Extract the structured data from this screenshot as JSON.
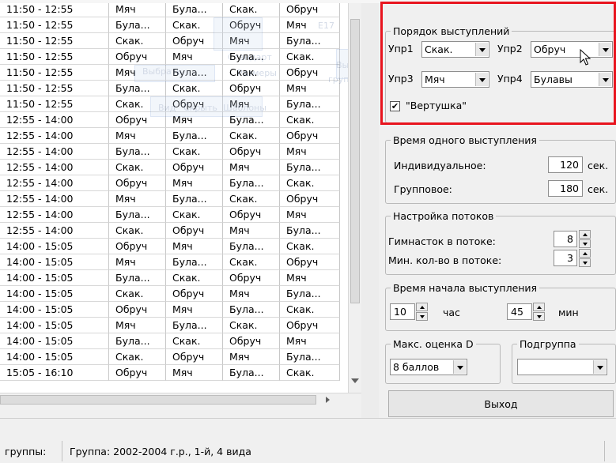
{
  "grid": {
    "rows": [
      [
        "11:50 - 12:55",
        "Мяч",
        "Була...",
        "Скак.",
        "Обруч"
      ],
      [
        "11:50 - 12:55",
        "Була...",
        "Скак.",
        "Обруч",
        "Мяч"
      ],
      [
        "11:50 - 12:55",
        "Скак.",
        "Обруч",
        "Мяч",
        "Була..."
      ],
      [
        "11:50 - 12:55",
        "Обруч",
        "Мяч",
        "Була...",
        "Скак."
      ],
      [
        "11:50 - 12:55",
        "Мяч",
        "Була...",
        "Скак.",
        "Обруч"
      ],
      [
        "11:50 - 12:55",
        "Була...",
        "Скак.",
        "Обруч",
        "Мяч"
      ],
      [
        "11:50 - 12:55",
        "Скак.",
        "Обруч",
        "Мяч",
        "Була..."
      ],
      [
        "12:55 - 14:00",
        "Обруч",
        "Мяч",
        "Була...",
        "Скак."
      ],
      [
        "12:55 - 14:00",
        "Мяч",
        "Була...",
        "Скак.",
        "Обруч"
      ],
      [
        "12:55 - 14:00",
        "Була...",
        "Скак.",
        "Обруч",
        "Мяч"
      ],
      [
        "12:55 - 14:00",
        "Скак.",
        "Обруч",
        "Мяч",
        "Була..."
      ],
      [
        "12:55 - 14:00",
        "Обруч",
        "Мяч",
        "Була...",
        "Скак."
      ],
      [
        "12:55 - 14:00",
        "Мяч",
        "Була...",
        "Скак.",
        "Обруч"
      ],
      [
        "12:55 - 14:00",
        "Була...",
        "Скак.",
        "Обруч",
        "Мяч"
      ],
      [
        "12:55 - 14:00",
        "Скак.",
        "Обруч",
        "Мяч",
        "Була..."
      ],
      [
        "14:00 - 15:05",
        "Обруч",
        "Мяч",
        "Була...",
        "Скак."
      ],
      [
        "14:00 - 15:05",
        "Мяч",
        "Була...",
        "Скак.",
        "Обруч"
      ],
      [
        "14:00 - 15:05",
        "Була...",
        "Скак.",
        "Обруч",
        "Мяч"
      ],
      [
        "14:00 - 15:05",
        "Скак.",
        "Обруч",
        "Мяч",
        "Була..."
      ],
      [
        "14:00 - 15:05",
        "Обруч",
        "Мяч",
        "Була...",
        "Скак."
      ],
      [
        "14:00 - 15:05",
        "Мяч",
        "Була...",
        "Скак.",
        "Обруч"
      ],
      [
        "14:00 - 15:05",
        "Була...",
        "Скак.",
        "Обруч",
        "Мяч"
      ],
      [
        "14:00 - 15:05",
        "Скак.",
        "Обруч",
        "Мяч",
        "Була..."
      ],
      [
        "15:05 - 16:10",
        "Обруч",
        "Мяч",
        "Була...",
        "Скак."
      ]
    ]
  },
  "ghost": {
    "t1": "Выбрать",
    "t2": "Стандарт",
    "t3": "Выделить",
    "t4": "группу",
    "t5": "Размеры",
    "t6": "Несколько",
    "t7": "Вид",
    "t8": "Скрыть",
    "t9": "Шаблоны",
    "t10": "Е17"
  },
  "order": {
    "legend": "Порядок выступлений",
    "ex1_label": "Упр1",
    "ex1_value": "Скак.",
    "ex2_label": "Упр2",
    "ex2_value": "Обруч",
    "ex3_label": "Упр3",
    "ex3_value": "Мяч",
    "ex4_label": "Упр4",
    "ex4_value": "Булавы",
    "spin_label": "\"Вертушка\"",
    "spin_checked": true
  },
  "perf_time": {
    "legend": "Время одного выступления",
    "individual_label": "Индивидуальное:",
    "individual_value": "120",
    "individual_unit": "сек.",
    "group_label": "Групповое:",
    "group_value": "180",
    "group_unit": "сек."
  },
  "streams": {
    "legend": "Настройка потоков",
    "per_stream_label": "Гимнасток в потоке:",
    "per_stream_value": "8",
    "min_label": "Мин. кол-во в потоке:",
    "min_value": "3"
  },
  "start_time": {
    "legend": "Время начала выступления",
    "hour_value": "10",
    "hour_unit": "час",
    "min_value": "45",
    "min_unit": "мин"
  },
  "max_d": {
    "legend": "Макс. оценка D",
    "value": "8 баллов"
  },
  "subgroup": {
    "legend": "Подгруппа",
    "value": ""
  },
  "exit_label": "Выход",
  "status": {
    "left": "группы:",
    "right": "Группа: 2002-2004 г.р., 1-й, 4 вида"
  },
  "colors": {
    "highlight": "#e8141e"
  }
}
